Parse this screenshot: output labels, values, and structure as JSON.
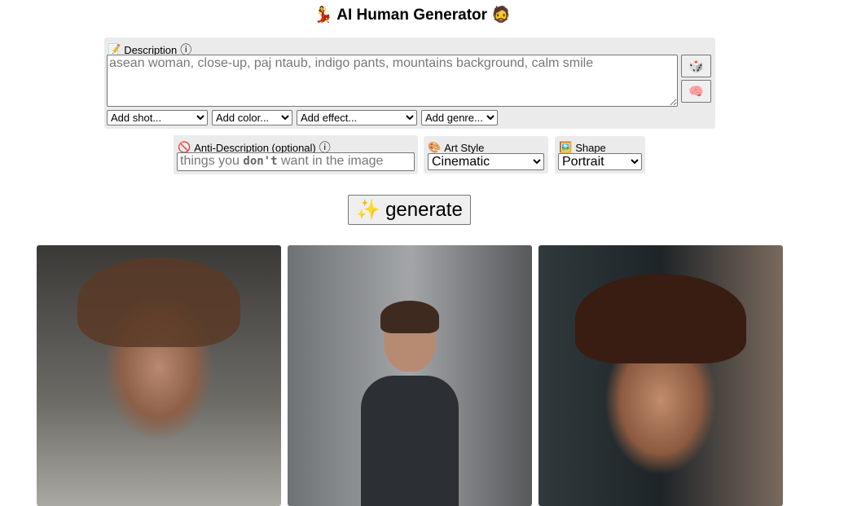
{
  "header": {
    "title": "AI Human Generator",
    "left_emoji": "💃",
    "right_emoji": "🧔"
  },
  "description": {
    "label": "Description",
    "label_icon": "📝",
    "info_icon": "ⓘ",
    "placeholder": "asean woman, close-up, paj ntaub, indigo pants, mountains background, calm smile",
    "value": "",
    "random_button_icon": "🎲",
    "brain_button_icon": "🧠",
    "dropdowns": [
      {
        "selected": "Add shot..."
      },
      {
        "selected": "Add color..."
      },
      {
        "selected": "Add effect..."
      },
      {
        "selected": "Add genre..."
      }
    ]
  },
  "anti_description": {
    "label": "Anti-Description (optional)",
    "label_icon": "🚫",
    "info_icon": "ⓘ",
    "placeholder": "things you don't want in the image",
    "placeholder_prefix": "things you",
    "placeholder_bold": "don't",
    "placeholder_suffix": "want in the image"
  },
  "art_style": {
    "label": "Art Style",
    "icon": "🎨",
    "selected": "Cinematic"
  },
  "shape": {
    "label": "Shape",
    "icon": "🖼️",
    "selected": "Portrait"
  },
  "generate": {
    "label": "generate",
    "icon": "✨"
  },
  "results": [
    {
      "alt": "generated portrait 1"
    },
    {
      "alt": "generated portrait 2"
    },
    {
      "alt": "generated portrait 3"
    }
  ]
}
